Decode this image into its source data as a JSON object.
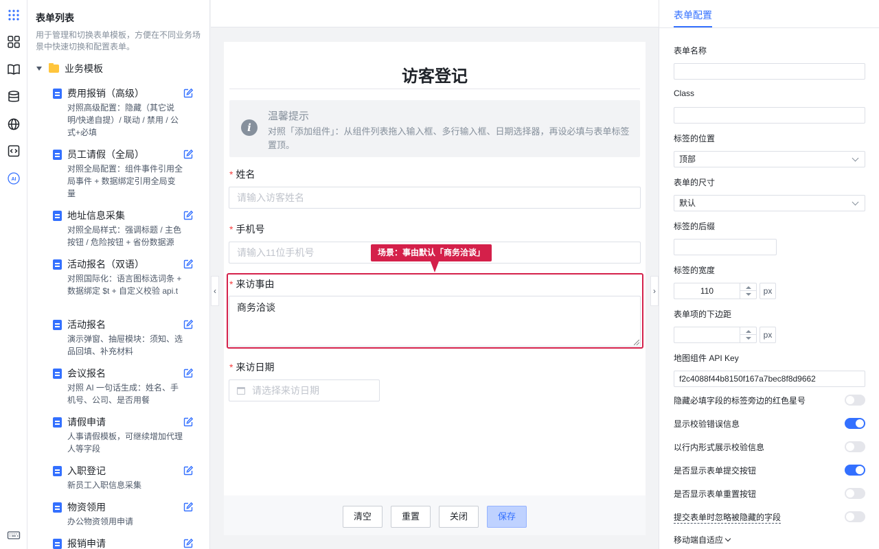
{
  "left_panel": {
    "title": "表单列表",
    "description": "用于管理和切换表单模板，方便在不同业务场景中快速切换和配置表单。",
    "folder": "业务模板",
    "templates": [
      {
        "name": "费用报销（高级）",
        "desc": "对照高级配置：隐藏（其它说明/快递自提）/ 联动 / 禁用 / 公式+必填"
      },
      {
        "name": "员工请假（全局）",
        "desc": "对照全局配置：组件事件引用全局事件 + 数据绑定引用全局变量"
      },
      {
        "name": "地址信息采集",
        "desc": "对照全局样式：强调标题 / 主色按钮 / 危险按钮 + 省份数据源"
      },
      {
        "name": "活动报名（双语）",
        "desc": "对照国际化：语言图标选词条 + 数据绑定 $t + 自定义校验 api.t"
      },
      {
        "name": "活动报名",
        "desc": "演示弹窗、抽屉模块：须知、选品回填、补充材料"
      },
      {
        "name": "会议报名",
        "desc": "对照 AI 一句话生成：姓名、手机号、公司、是否用餐"
      },
      {
        "name": "请假申请",
        "desc": "人事请假模板，可继续增加代理人等字段"
      },
      {
        "name": "入职登记",
        "desc": "新员工入职信息采集"
      },
      {
        "name": "物资领用",
        "desc": "办公物资领用申请"
      },
      {
        "name": "报销申请",
        "desc": ""
      }
    ]
  },
  "canvas": {
    "form_title": "访客登记",
    "tip_title": "温馨提示",
    "tip_body": "对照「添加组件」：从组件列表拖入输入框、多行输入框、日期选择器，再设必填与表单标签置顶。",
    "required_mark": "*",
    "fields": {
      "name_label": "姓名",
      "name_placeholder": "请输入访客姓名",
      "phone_label": "手机号",
      "phone_placeholder": "请输入11位手机号",
      "reason_label": "来访事由",
      "reason_value": "商务洽谈",
      "date_label": "来访日期",
      "date_placeholder": "请选择来访日期"
    },
    "scene_tag": "场景：事由默认「商务洽谈」",
    "buttons": {
      "clear": "清空",
      "reset": "重置",
      "close": "关闭",
      "save": "保存"
    }
  },
  "right_panel": {
    "tab": "表单配置",
    "form_name_label": "表单名称",
    "form_name_value": "",
    "class_label": "Class",
    "class_value": "",
    "label_position_label": "标签的位置",
    "label_position_value": "顶部",
    "form_size_label": "表单的尺寸",
    "form_size_value": "默认",
    "label_suffix_label": "标签的后缀",
    "label_suffix_value": "",
    "label_width_label": "标签的宽度",
    "label_width_value": "110",
    "unit": "px",
    "item_margin_label": "表单项的下边距",
    "item_margin_value": "",
    "map_key_label": "地图组件 API Key",
    "map_key_value": "f2c4088f44b8150f167a7bec8f8d9662",
    "switches": [
      {
        "label": "隐藏必填字段的标签旁边的红色星号",
        "on": false
      },
      {
        "label": "显示校验错误信息",
        "on": true
      },
      {
        "label": "以行内形式展示校验信息",
        "on": false
      },
      {
        "label": "是否显示表单提交按钮",
        "on": true
      },
      {
        "label": "是否显示表单重置按钮",
        "on": false
      },
      {
        "label": "提交表单时忽略被隐藏的字段",
        "on": false
      }
    ],
    "mobile_label": "移动端自适应"
  },
  "colors": {
    "primary": "#3370ff",
    "danger": "#d4204a",
    "folder": "#ffc53d"
  }
}
